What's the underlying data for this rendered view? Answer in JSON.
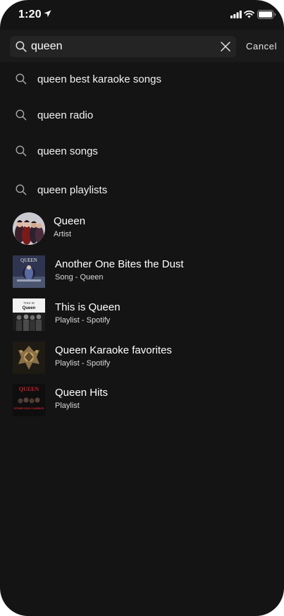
{
  "status_bar": {
    "time": "1:20",
    "location_icon": "location-arrow-icon",
    "signal_icon": "cellular-signal-icon",
    "wifi_icon": "wifi-icon",
    "battery_icon": "battery-icon"
  },
  "search": {
    "query": "queen",
    "icon": "search-icon",
    "clear_icon": "close-icon",
    "cancel_label": "Cancel"
  },
  "suggestions": [
    {
      "label": "queen best karaoke songs",
      "icon": "search-icon"
    },
    {
      "label": "queen radio",
      "icon": "search-icon"
    },
    {
      "label": "queen songs",
      "icon": "search-icon"
    },
    {
      "label": "queen playlists",
      "icon": "search-icon"
    }
  ],
  "results": [
    {
      "title": "Queen",
      "subtitle": "Artist",
      "image": "artist-photo"
    },
    {
      "title": "Another One Bites the Dust",
      "subtitle": "Song - Queen",
      "image": "album-cover",
      "art_text": "QUEEN"
    },
    {
      "title": "This is Queen",
      "subtitle": "Playlist - Spotify",
      "image": "playlist-cover",
      "art_text": [
        "THIS IS",
        "Queen"
      ]
    },
    {
      "title": "Queen Karaoke favorites",
      "subtitle": "Playlist - Spotify",
      "image": "crest-cover"
    },
    {
      "title": "Queen Hits",
      "subtitle": "Playlist",
      "image": "album-cover",
      "art_text": [
        "QUEEN",
        "STONE COLD CLASSICS"
      ]
    }
  ],
  "colors": {
    "background": "#141414",
    "header": "#1a1a1a",
    "search_field": "#242424",
    "text": "#ffffff",
    "subtext": "#d9d9d9"
  }
}
